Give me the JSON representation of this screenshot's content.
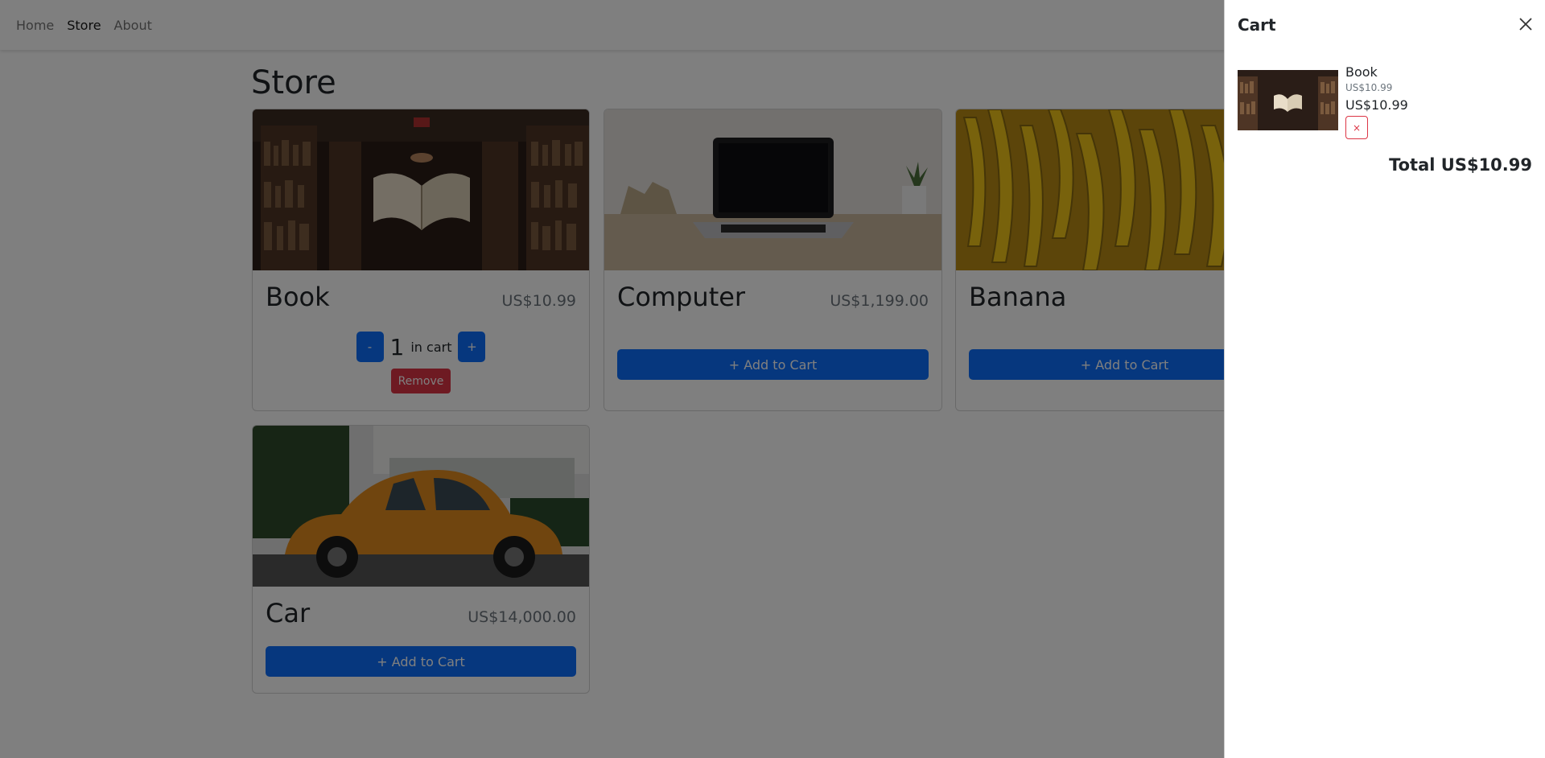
{
  "nav": {
    "items": [
      "Home",
      "Store",
      "About"
    ],
    "active": "Store"
  },
  "page": {
    "title": "Store"
  },
  "products": {
    "book": {
      "name": "Book",
      "price": "US$10.99",
      "quantity": "1",
      "in_cart_label": "in cart",
      "minus": "-",
      "plus": "+",
      "remove": "Remove"
    },
    "computer": {
      "name": "Computer",
      "price": "US$1,199.00",
      "add": "+ Add to Cart"
    },
    "banana": {
      "name": "Banana",
      "add": "+ Add to Cart"
    },
    "car": {
      "name": "Car",
      "price": "US$14,000.00",
      "add": "+ Add to Cart"
    }
  },
  "cart": {
    "title": "Cart",
    "items": [
      {
        "name": "Book",
        "unit_price": "US$10.99",
        "line_total": "US$10.99",
        "remove_glyph": "×"
      }
    ],
    "total": "Total US$10.99"
  },
  "colors": {
    "primary": "#0d6efd",
    "danger": "#dc3545",
    "overlay": "rgba(0,0,0,0.5)"
  },
  "icons": [
    "close-icon"
  ]
}
